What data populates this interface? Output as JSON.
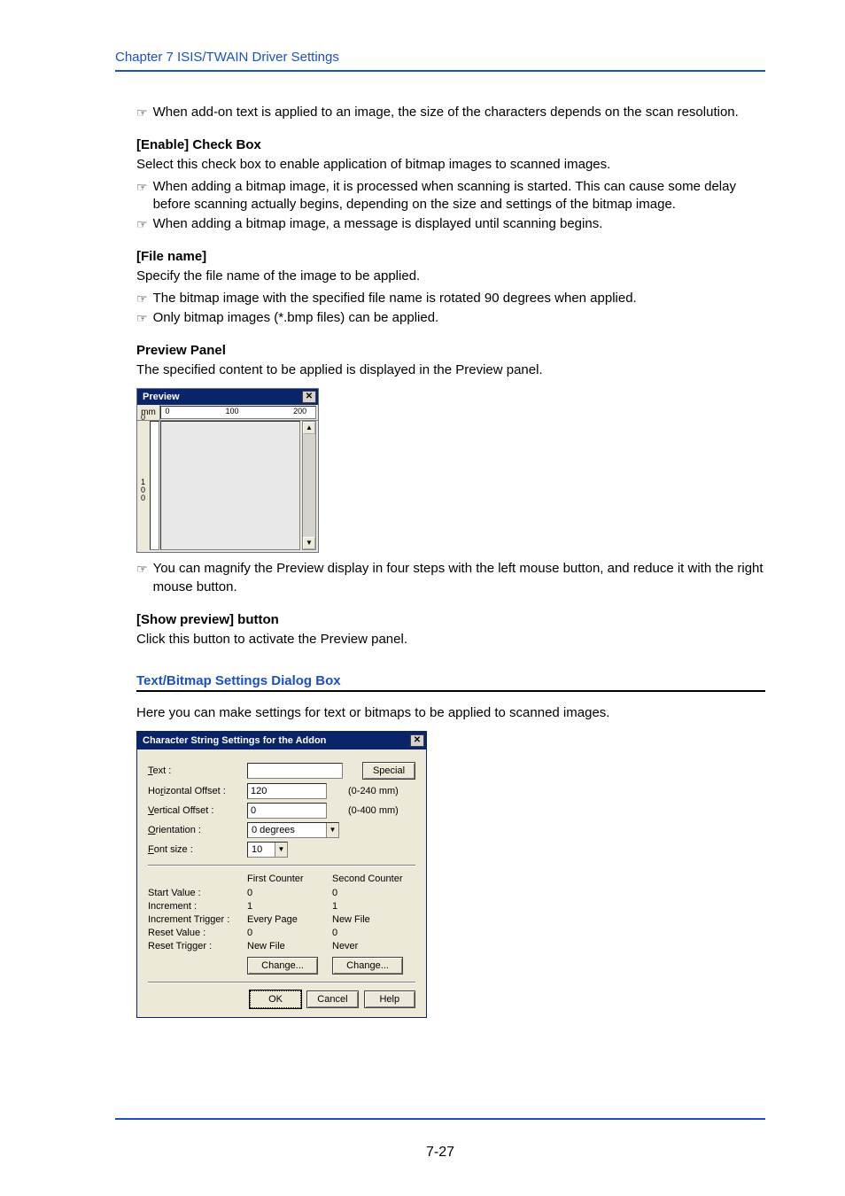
{
  "chapter_header": "Chapter 7   ISIS/TWAIN Driver Settings",
  "note_addon": "When add-on text is applied to an image, the size of the characters depends on the scan resolution.",
  "enable": {
    "heading": "[Enable] Check Box",
    "desc": "Select this check box to enable application of bitmap images to scanned images.",
    "note1": "When adding a bitmap image, it is processed when scanning is started. This can cause some delay before scanning actually begins, depending on the size and settings of the bitmap image.",
    "note2": "When adding a bitmap image, a message is displayed until scanning begins."
  },
  "filename": {
    "heading": "[File name]",
    "desc": "Specify the file name of the image to be applied.",
    "note1": "The bitmap image with the specified file name is rotated 90 degrees when applied.",
    "note2": "Only bitmap images (*.bmp files) can be applied."
  },
  "preview": {
    "heading": "Preview Panel",
    "desc": "The specified content to be applied is displayed in the Preview panel.",
    "title": "Preview",
    "unit": "mm",
    "ruler_0": "0",
    "ruler_100": "100",
    "ruler_200": "200",
    "v_0": "0",
    "v_100a": "1",
    "v_100b": "0",
    "v_100c": "0",
    "note_after": "You can magnify the Preview display in four steps with the left mouse button, and reduce it with the right mouse button."
  },
  "show_preview": {
    "heading": "[Show preview] button",
    "desc": "Click this button to activate the Preview panel."
  },
  "section_title": "Text/Bitmap Settings Dialog Box",
  "section_desc": "Here you can make settings for text or bitmaps to be applied to scanned images.",
  "dialog": {
    "title": "Character String Settings for the Addon",
    "text_label_pre": "T",
    "text_label_post": "ext :",
    "special_pre": "Specia",
    "special_post": "l",
    "hoff_pre": "Ho",
    "hoff_ul": "r",
    "hoff_post": "izontal Offset :",
    "hoff_val": "120",
    "hoff_suffix": "(0-240 mm)",
    "voff_ul": "V",
    "voff_post": "ertical Offset :",
    "voff_val": "0",
    "voff_suffix": "(0-400 mm)",
    "orient_ul": "O",
    "orient_post": "rientation :",
    "orient_val": "0 degrees",
    "font_ul": "F",
    "font_post": "ont size :",
    "font_val": "10",
    "col1": "First Counter",
    "col2": "Second Counter",
    "r1_label": "Start Value :",
    "r1_c1": "0",
    "r1_c2": "0",
    "r2_label": "Increment :",
    "r2_c1": "1",
    "r2_c2": "1",
    "r3_label": "Increment Trigger :",
    "r3_c1": "Every Page",
    "r3_c2": "New File",
    "r4_label": "Reset Value :",
    "r4_c1": "0",
    "r4_c2": "0",
    "r5_label": "Reset Trigger :",
    "r5_c1": "New File",
    "r5_c2": "Never",
    "change_ul": "C",
    "change_post": "hange...",
    "change2_pre": "Cha",
    "change2_ul": "n",
    "change2_post": "ge...",
    "ok": "OK",
    "cancel": "Cancel",
    "help_ul": "H",
    "help_post": "elp"
  },
  "page_number": "7-27"
}
